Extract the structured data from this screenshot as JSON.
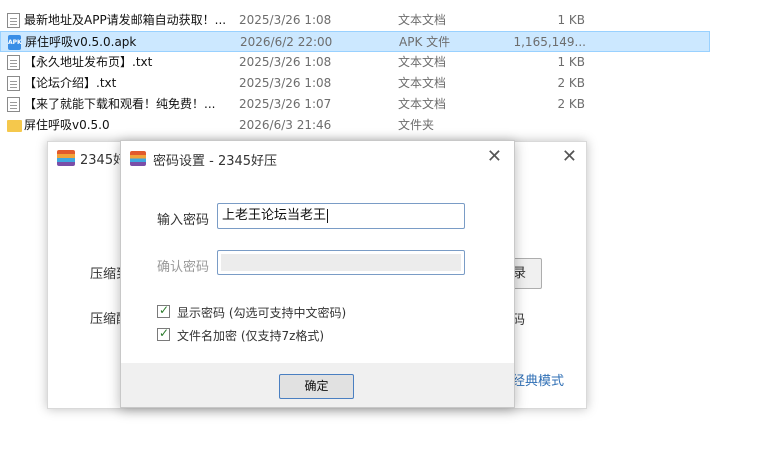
{
  "files": [
    {
      "name": "最新地址及APP请发邮箱自动获取！...",
      "date": "2025/3/26 1:08",
      "type": "文本文档",
      "size": "1 KB",
      "icon": "text-document-icon",
      "selected": false
    },
    {
      "name": "屏住呼吸v0.5.0.apk",
      "date": "2026/6/2 22:00",
      "type": "APK 文件",
      "size": "1,165,149...",
      "icon": "apk-file-icon",
      "selected": true
    },
    {
      "name": "【永久地址发布页】.txt",
      "date": "2025/3/26 1:08",
      "type": "文本文档",
      "size": "1 KB",
      "icon": "text-document-icon",
      "selected": false
    },
    {
      "name": "【论坛介绍】.txt",
      "date": "2025/3/26 1:08",
      "type": "文本文档",
      "size": "2 KB",
      "icon": "text-document-icon",
      "selected": false
    },
    {
      "name": "【来了就能下载和观看！纯免费！...",
      "date": "2025/3/26 1:07",
      "type": "文本文档",
      "size": "2 KB",
      "icon": "text-document-icon",
      "selected": false
    },
    {
      "name": "屏住呼吸v0.5.0",
      "date": "2026/6/3 21:46",
      "type": "文件夹",
      "size": "",
      "icon": "folder-icon",
      "selected": false
    }
  ],
  "main_window": {
    "title": "2345好",
    "close_icon": "close-icon",
    "compress_label_1": "压缩到",
    "compress_label_2": "压缩配",
    "browse_label": "录",
    "password_link": "码",
    "classic_mode": "经典模式"
  },
  "dialog": {
    "title": "密码设置 - 2345好压",
    "password_label": "输入密码",
    "password_value": "上老王论坛当老王",
    "confirm_label": "确认密码",
    "confirm_value": "",
    "show_password": {
      "label": "显示密码 (勾选可支持中文密码)",
      "checked": true
    },
    "encrypt_filename": {
      "label": "文件名加密  (仅支持7z格式)",
      "checked": true
    },
    "ok_label": "确定"
  },
  "colors": {
    "selection": "#cce8ff",
    "accent_border": "#7a9cc6",
    "link": "#2f6fb5"
  }
}
